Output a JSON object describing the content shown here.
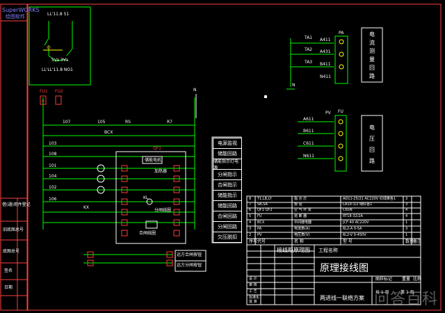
{
  "logo": {
    "brand": "SuperWORKS",
    "subtitle": "绘图软件"
  },
  "sidebar": {
    "labels": [
      "借(通)用件登记",
      "旧底图总号",
      "底图总号",
      "签名",
      "日期"
    ]
  },
  "inset": {
    "top_label": "LL'11.8 51",
    "bottom_label": "LL'LL'11.8 NO1",
    "pot_label": "5Va 3Va"
  },
  "main_labels": {
    "fu1": "FU1",
    "fu2": "FU2",
    "rs": "RS",
    "r7": "R7",
    "nn": "N",
    "line_107": "107",
    "line_105": "105",
    "line_103": "103",
    "line_108": "108",
    "line_101": "101",
    "line_104": "104",
    "line_102": "102",
    "line_106": "106",
    "kl": "KL",
    "kx": "KX",
    "bcx": "BCX",
    "qf1": "QF1",
    "ka": "KA",
    "kv": "KV",
    "store_energy": "储能电机",
    "heat": "加热器",
    "trip": "分闸线圈",
    "close": "合闸线圈",
    "remote_close": "远方合闸",
    "remote_open": "远方分闸"
  },
  "function_labels": [
    "电源监视",
    "储能回路",
    "储能指示灯电源",
    "分闸指示",
    "合闸指示",
    "储能指示",
    "储能回路",
    "合闸回路",
    "分闸回路",
    "欠压脱扣"
  ],
  "lower_labels": {
    "remote_close": "远方合闸按钮",
    "remote_open": "远方分闸按钮"
  },
  "right_top": {
    "title_chars": [
      "电",
      "流",
      "测",
      "量",
      "回",
      "路"
    ],
    "labels": [
      "TA1",
      "TA2",
      "TA3",
      "A411",
      "A431",
      "B411",
      "N411"
    ],
    "n_label": "N",
    "pa": "PA"
  },
  "right_mid": {
    "title_chars": [
      "电",
      "压",
      "回",
      "路"
    ],
    "labels": [
      "A611",
      "B611",
      "C611",
      "N611",
      "PV",
      "FU"
    ]
  },
  "parts_table": {
    "rows": [
      [
        "8",
        "T1,LB,LY",
        "指 示 灯",
        "AD11-25/21 AC220V 红绿黄各1",
        "3",
        ""
      ],
      [
        "7",
        "SB,SA",
        "按    钮",
        "LA10-1/2 绿红各1",
        "3",
        ""
      ],
      [
        "6",
        "QF1 QF2",
        "空 气 开 关",
        "C65N",
        "4",
        ""
      ],
      [
        "5",
        "FU",
        "熔 断 器",
        "RT18-32/2A",
        "4",
        ""
      ],
      [
        "4",
        "BCX",
        "中间继电器",
        "JCF-40 AC220V",
        "1",
        ""
      ],
      [
        "3",
        "PA",
        "电流表(A)",
        "6L2-A 0-5A",
        "3",
        ""
      ],
      [
        "2",
        "PV",
        "电压表(V)",
        "6L2-V 0-450V",
        "1",
        ""
      ],
      [
        "1",
        "QF",
        "真空断路器",
        "ZN63-12/630-25",
        "1",
        ""
      ]
    ],
    "header": [
      "序号",
      "代号",
      "名    称",
      "型    号",
      "数量",
      "备注"
    ]
  },
  "title_block": {
    "project_label": "工程名称",
    "project_name": "接线柜原理图",
    "drawing_title": "原理接线图",
    "scheme": "两进线一联络方案",
    "stage_label": "图样标记",
    "weight_label": "重量",
    "scale_label": "比例",
    "sheet": "共 1 页",
    "sheet_of": "第 1 页",
    "roles": [
      "设 计",
      "审 核",
      "工 艺",
      "标准化",
      "批 准"
    ],
    "cols": [
      "标记",
      "处数",
      "分区",
      "更改文件号",
      "签名",
      "年.月.日"
    ]
  },
  "watermark": "问答百科"
}
